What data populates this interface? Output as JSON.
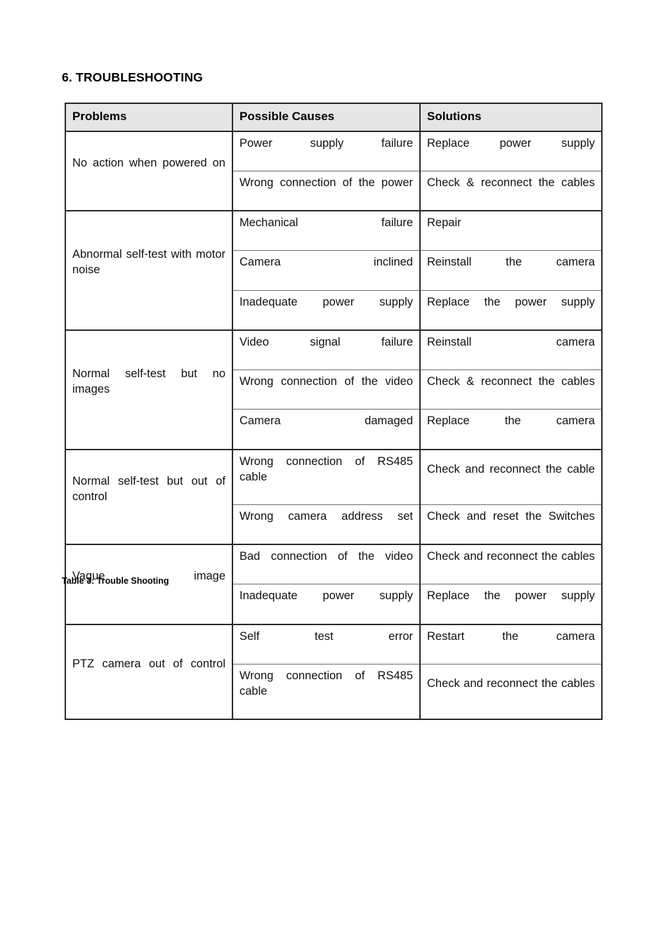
{
  "document": {
    "section_heading": "6. TROUBLESHOOTING",
    "caption": "Table 3: Trouble Shooting"
  },
  "table": {
    "headers": {
      "problems": "Problems",
      "causes": "Possible Causes",
      "solutions": "Solutions"
    },
    "groups": [
      {
        "problem": "No action when powered on",
        "rows": [
          {
            "cause": "Power supply failure",
            "solution": "Replace power supply"
          },
          {
            "cause": "Wrong connection of the power",
            "solution": "Check & reconnect the cables"
          }
        ]
      },
      {
        "problem": "Abnormal self-test with motor noise",
        "rows": [
          {
            "cause": "Mechanical failure",
            "solution": "Repair"
          },
          {
            "cause": "Camera inclined",
            "solution": "Reinstall the camera"
          },
          {
            "cause": "Inadequate power supply",
            "solution": "Replace the power supply"
          }
        ]
      },
      {
        "problem": "Normal self-test but no images",
        "rows": [
          {
            "cause": "Video signal failure",
            "solution": "Reinstall camera"
          },
          {
            "cause": "Wrong connection of the video",
            "solution": "Check & reconnect the cables"
          },
          {
            "cause": "Camera damaged",
            "solution": "Replace the camera"
          }
        ]
      },
      {
        "problem": "Normal self-test but out of control",
        "rows": [
          {
            "cause": "Wrong connection of RS485 cable",
            "solution": "Check and reconnect the cable"
          },
          {
            "cause": "Wrong camera address set",
            "solution": "Check and reset the Switches"
          }
        ]
      },
      {
        "problem": "Vague image",
        "rows": [
          {
            "cause": "Bad connection of the video",
            "solution": "Check and reconnect the cables"
          },
          {
            "cause": "Inadequate power supply",
            "solution": "Replace the power supply"
          }
        ]
      },
      {
        "problem": "PTZ camera out of control",
        "rows": [
          {
            "cause": "Self test error",
            "solution": "Restart the camera"
          },
          {
            "cause": "Wrong connection of RS485 cable",
            "solution": "Check and reconnect the cables"
          }
        ]
      }
    ]
  },
  "colors": {
    "header_background": "#e6e6e6",
    "border_outer": "#2b2b2b",
    "border_inner": "#6e6e6e",
    "text": "#111111"
  }
}
